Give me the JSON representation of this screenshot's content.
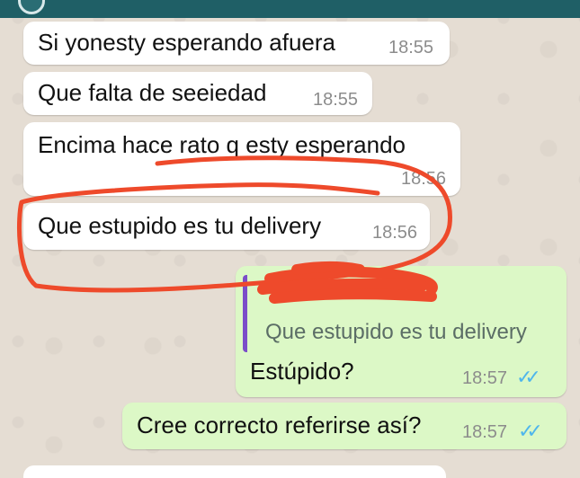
{
  "messages": [
    {
      "text": "Si yonesty esperando afuera",
      "time": "18:55",
      "dir": "in"
    },
    {
      "text": "Que falta de seeiedad",
      "time": "18:55",
      "dir": "in"
    },
    {
      "text": "Encima hace rato q esty esperando",
      "time": "18:56",
      "dir": "in"
    },
    {
      "text": "Que estupido es tu delivery",
      "time": "18:56",
      "dir": "in"
    },
    {
      "text": "Estúpido?",
      "time": "18:57",
      "dir": "out",
      "quoted": "Que estupido es tu delivery",
      "ticks": "✓✓"
    },
    {
      "text": "Cree correcto referirse así?",
      "time": "18:57",
      "dir": "out",
      "ticks": "✓✓"
    }
  ],
  "colors": {
    "incoming_bubble": "#ffffff",
    "outgoing_bubble": "#dcf8c6",
    "read_ticks": "#4fb6ec",
    "header": "#1f5f66",
    "scribble": "#ee4a2b",
    "quote_bar": "#7b4dc9"
  }
}
